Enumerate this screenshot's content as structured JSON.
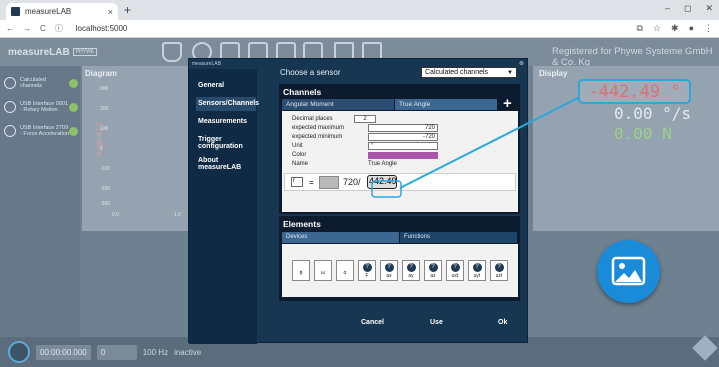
{
  "browser": {
    "tab_title": "measureLAB",
    "tab_close": "×",
    "new_tab": "+",
    "url": "localhost:5000",
    "nav": {
      "back": "←",
      "forward": "→",
      "reload": "C",
      "info": "ⓘ"
    },
    "icons": [
      "⧉",
      "☆",
      "✱",
      "●",
      "⋮"
    ],
    "window": {
      "min": "–",
      "max": "◻",
      "close": "✕"
    }
  },
  "app": {
    "logo": "measureLAB",
    "logo_badge": "PHYWE",
    "registered": "Registered for Phywe Systeme GmbH & Co. Kg",
    "sidebar": [
      {
        "label": "Calculated channels"
      },
      {
        "label": "USB Interface 0001 - Rotary Motion"
      },
      {
        "label": "USB Interface 2709 - Force Acceleration"
      }
    ],
    "chart": {
      "title": "Diagram",
      "ylabel": "Angle ϕ [°]",
      "yticks": [
        "300",
        "200",
        "100",
        "0",
        "-100",
        "-200",
        "-300"
      ],
      "xticks": [
        "0.0",
        "1.0"
      ]
    },
    "display": {
      "title": "Display",
      "value1": "-442.49 °",
      "value2": "0.00 °/s",
      "value3": "0.00 N"
    },
    "bottom": {
      "time": "00:00:00.000",
      "count": "0",
      "rate": "100 Hz",
      "status": "inactive"
    }
  },
  "dialog": {
    "header_logo": "measureLAB",
    "close": "⊗",
    "nav": [
      {
        "label": "General"
      },
      {
        "label": "Sensors/Channels"
      },
      {
        "label": "Measurements"
      },
      {
        "label": "Trigger configuration"
      },
      {
        "label": "About measureLAB"
      }
    ],
    "choose_label": "Choose a sensor",
    "sensor_select": "Calculated channels",
    "channels": {
      "title": "Channels",
      "tabs": [
        "Angular Moment",
        "True Angle"
      ],
      "add": "+",
      "fields": [
        {
          "label": "Decimal places",
          "value": "2"
        },
        {
          "label": "expected maximum",
          "value": "720"
        },
        {
          "label": "expected minimum",
          "value": "-720"
        },
        {
          "label": "Unit",
          "value": "°"
        },
        {
          "label": "Color",
          "value": ""
        },
        {
          "label": "Name",
          "value": "True Angle"
        }
      ],
      "formula": {
        "var": "r",
        "eq": "=",
        "expr": "720/",
        "result": "442.49"
      }
    },
    "elements": {
      "title": "Elements",
      "tabs": [
        "Devices",
        "Functions"
      ],
      "buttons": [
        {
          "label": "ϕ",
          "icon": false
        },
        {
          "label": "ω",
          "icon": false
        },
        {
          "label": "α",
          "icon": false
        },
        {
          "label": "F",
          "icon": true
        },
        {
          "label": "ax",
          "icon": true
        },
        {
          "label": "ay",
          "icon": true
        },
        {
          "label": "az",
          "icon": true
        },
        {
          "label": "uxt",
          "icon": true
        },
        {
          "label": "uyt",
          "icon": true
        },
        {
          "label": "uzt",
          "icon": true
        }
      ]
    },
    "buttons": {
      "cancel": "Cancel",
      "use": "Use",
      "ok": "Ok"
    }
  },
  "colors": {
    "accent": "#2aa8dc",
    "channel_color": "#a856a8",
    "dialog_bg": "#173652"
  }
}
